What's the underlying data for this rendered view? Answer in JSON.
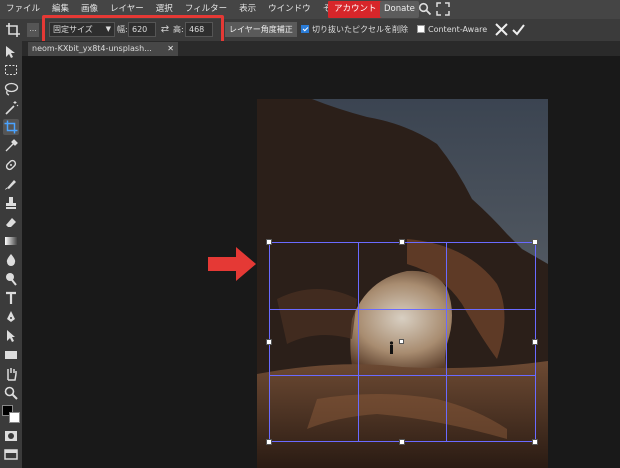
{
  "menu": {
    "items": [
      "ファイル",
      "編集",
      "画像",
      "レイヤー",
      "選択",
      "フィルター",
      "表示",
      "ウインドウ",
      "その他"
    ],
    "account": "アカウント",
    "donate": "Donate"
  },
  "options": {
    "more": "...",
    "mode": "固定サイズ",
    "width_label": "幅:",
    "width_value": "620",
    "height_label": "高:",
    "height_value": "468",
    "layer_angle_btn": "レイヤー角度補正",
    "delete_cropped_label": "切り抜いたピクセルを削除",
    "delete_cropped_checked": true,
    "content_aware_label": "Content-Aware",
    "content_aware_checked": false
  },
  "document": {
    "tab_title": "neom-KXbit_yx8t4-unsplash..."
  },
  "colors": {
    "accent_red": "#e53935",
    "crop_line": "#6a6aff",
    "account_bg": "#d7262a"
  }
}
